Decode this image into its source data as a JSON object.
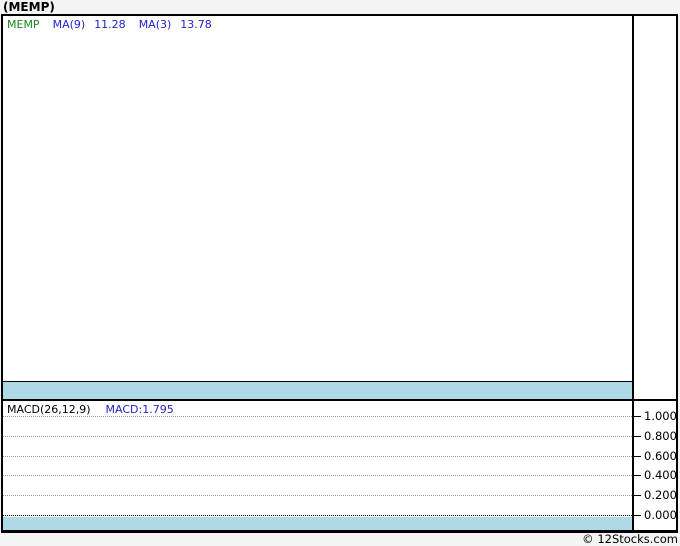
{
  "page": {
    "title": "(MEMP)",
    "copyright": "© 12Stocks.com"
  },
  "colors": {
    "background": "#f4f4f4",
    "border": "#000000",
    "band": "#aed9e6",
    "legend_symbol_green": "#1a8a1a",
    "indicator_blue": "#2222cc",
    "gridline_gray": "#999999"
  },
  "main_panel": {
    "legend": {
      "symbol": "MEMP",
      "ma1_label": "MA(9)",
      "ma1_value": "11.28",
      "ma2_label": "MA(3)",
      "ma2_value": "13.78"
    }
  },
  "macd_panel": {
    "label": "MACD(26,12,9)",
    "value_label": "MACD:1.795"
  },
  "chart_data": {
    "type": "line",
    "title": "(MEMP)",
    "panels": [
      {
        "name": "price",
        "legend": [
          "MEMP",
          "MA(9) 11.28",
          "MA(3) 13.78"
        ],
        "indicators": {
          "MA(9)": 11.28,
          "MA(3)": 13.78
        },
        "series": [],
        "note_series_visible": false,
        "grid": "off"
      },
      {
        "name": "macd",
        "legend": [
          "MACD(26,12,9)",
          "MACD:1.795"
        ],
        "indicator_value": 1.795,
        "ylim": [
          0.0,
          1.0
        ],
        "yticks": [
          1.0,
          0.8,
          0.6,
          0.4,
          0.2,
          0.0
        ],
        "ytick_labels": [
          "1.000",
          "0.800",
          "0.600",
          "0.400",
          "0.200",
          "0.000"
        ],
        "series": [],
        "note_series_visible": false,
        "grid": "dotted-horizontal",
        "axis_position": "right"
      }
    ]
  }
}
